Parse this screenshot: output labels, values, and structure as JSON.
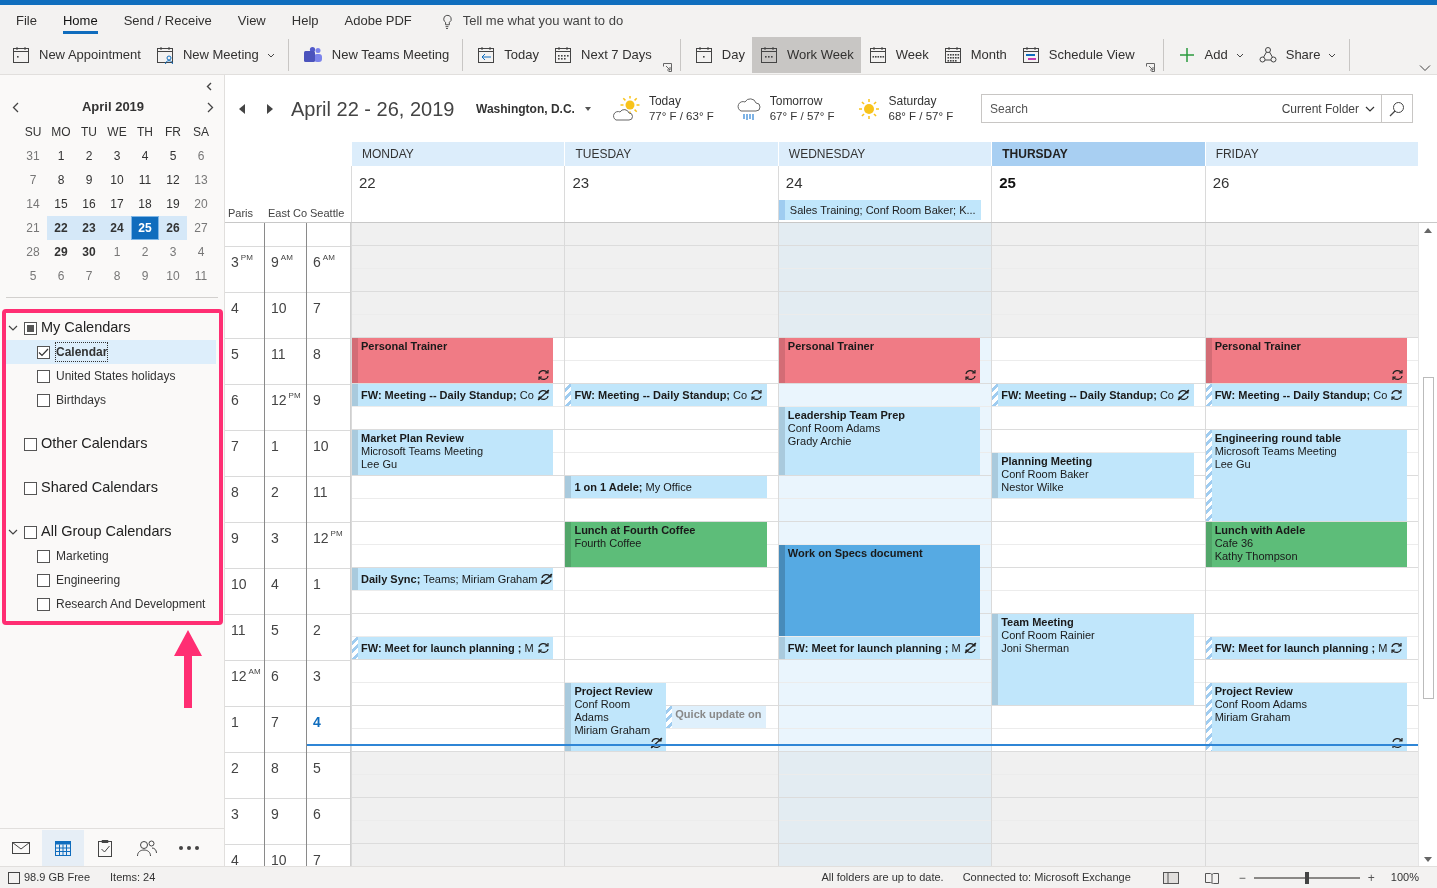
{
  "ribbon": {
    "tabs": [
      {
        "label": "File",
        "selected": false
      },
      {
        "label": "Home",
        "selected": true
      },
      {
        "label": "Send / Receive",
        "selected": false
      },
      {
        "label": "View",
        "selected": false
      },
      {
        "label": "Help",
        "selected": false
      },
      {
        "label": "Adobe PDF",
        "selected": false
      }
    ],
    "tell_me": "Tell me what you want to do",
    "groups": [
      {
        "launcher": false,
        "buttons": [
          {
            "kind": "appointment",
            "label": "New Appointment",
            "dropdown": false,
            "selected": false
          },
          {
            "kind": "meeting",
            "label": "New Meeting",
            "dropdown": true,
            "selected": false
          }
        ]
      },
      {
        "launcher": false,
        "buttons": [
          {
            "kind": "teams",
            "label": "New Teams Meeting",
            "dropdown": false,
            "selected": false
          }
        ]
      },
      {
        "launcher": true,
        "buttons": [
          {
            "kind": "today",
            "label": "Today",
            "dropdown": false,
            "selected": false
          },
          {
            "kind": "next7",
            "label": "Next 7 Days",
            "dropdown": false,
            "selected": false
          }
        ]
      },
      {
        "launcher": true,
        "buttons": [
          {
            "kind": "day",
            "label": "Day",
            "dropdown": false,
            "selected": false
          },
          {
            "kind": "workweek",
            "label": "Work Week",
            "dropdown": false,
            "selected": true
          },
          {
            "kind": "week",
            "label": "Week",
            "dropdown": false,
            "selected": false
          },
          {
            "kind": "month",
            "label": "Month",
            "dropdown": false,
            "selected": false
          },
          {
            "kind": "schedule",
            "label": "Schedule View",
            "dropdown": false,
            "selected": false
          }
        ]
      },
      {
        "launcher": false,
        "buttons": [
          {
            "kind": "add",
            "label": "Add",
            "dropdown": true,
            "selected": false
          },
          {
            "kind": "share",
            "label": "Share",
            "dropdown": true,
            "selected": false
          }
        ]
      }
    ]
  },
  "minical": {
    "title": "April 2019",
    "weekdays": [
      "SU",
      "MO",
      "TU",
      "WE",
      "TH",
      "FR",
      "SA"
    ],
    "weeks": [
      [
        {
          "d": "31",
          "muted": true,
          "bold": false,
          "selected": false,
          "today": false
        },
        {
          "d": "1",
          "muted": false,
          "bold": false,
          "selected": false,
          "today": false
        },
        {
          "d": "2",
          "muted": false,
          "bold": false,
          "selected": false,
          "today": false
        },
        {
          "d": "3",
          "muted": false,
          "bold": false,
          "selected": false,
          "today": false
        },
        {
          "d": "4",
          "muted": false,
          "bold": false,
          "selected": false,
          "today": false
        },
        {
          "d": "5",
          "muted": false,
          "bold": false,
          "selected": false,
          "today": false
        },
        {
          "d": "6",
          "muted": true,
          "bold": false,
          "selected": false,
          "today": false
        }
      ],
      [
        {
          "d": "7",
          "muted": true,
          "bold": false,
          "selected": false,
          "today": false
        },
        {
          "d": "8",
          "muted": false,
          "bold": false,
          "selected": false,
          "today": false
        },
        {
          "d": "9",
          "muted": false,
          "bold": false,
          "selected": false,
          "today": false
        },
        {
          "d": "10",
          "muted": false,
          "bold": false,
          "selected": false,
          "today": false
        },
        {
          "d": "11",
          "muted": false,
          "bold": false,
          "selected": false,
          "today": false
        },
        {
          "d": "12",
          "muted": false,
          "bold": false,
          "selected": false,
          "today": false
        },
        {
          "d": "13",
          "muted": true,
          "bold": false,
          "selected": false,
          "today": false
        }
      ],
      [
        {
          "d": "14",
          "muted": true,
          "bold": false,
          "selected": false,
          "today": false
        },
        {
          "d": "15",
          "muted": false,
          "bold": false,
          "selected": false,
          "today": false
        },
        {
          "d": "16",
          "muted": false,
          "bold": false,
          "selected": false,
          "today": false
        },
        {
          "d": "17",
          "muted": false,
          "bold": false,
          "selected": false,
          "today": false
        },
        {
          "d": "18",
          "muted": false,
          "bold": false,
          "selected": false,
          "today": false
        },
        {
          "d": "19",
          "muted": false,
          "bold": false,
          "selected": false,
          "today": false
        },
        {
          "d": "20",
          "muted": true,
          "bold": false,
          "selected": false,
          "today": false
        }
      ],
      [
        {
          "d": "21",
          "muted": true,
          "bold": false,
          "selected": false,
          "today": false
        },
        {
          "d": "22",
          "muted": false,
          "bold": true,
          "selected": true,
          "today": false
        },
        {
          "d": "23",
          "muted": false,
          "bold": true,
          "selected": true,
          "today": false
        },
        {
          "d": "24",
          "muted": false,
          "bold": true,
          "selected": true,
          "today": false
        },
        {
          "d": "25",
          "muted": false,
          "bold": true,
          "selected": true,
          "today": true
        },
        {
          "d": "26",
          "muted": false,
          "bold": true,
          "selected": true,
          "today": false
        },
        {
          "d": "27",
          "muted": true,
          "bold": false,
          "selected": false,
          "today": false
        }
      ],
      [
        {
          "d": "28",
          "muted": true,
          "bold": false,
          "selected": false,
          "today": false
        },
        {
          "d": "29",
          "muted": false,
          "bold": true,
          "selected": false,
          "today": false
        },
        {
          "d": "30",
          "muted": false,
          "bold": true,
          "selected": false,
          "today": false
        },
        {
          "d": "1",
          "muted": true,
          "bold": false,
          "selected": false,
          "today": false
        },
        {
          "d": "2",
          "muted": true,
          "bold": false,
          "selected": false,
          "today": false
        },
        {
          "d": "3",
          "muted": true,
          "bold": false,
          "selected": false,
          "today": false
        },
        {
          "d": "4",
          "muted": true,
          "bold": false,
          "selected": false,
          "today": false
        }
      ],
      [
        {
          "d": "5",
          "muted": true,
          "bold": false,
          "selected": false,
          "today": false
        },
        {
          "d": "6",
          "muted": true,
          "bold": false,
          "selected": false,
          "today": false
        },
        {
          "d": "7",
          "muted": true,
          "bold": false,
          "selected": false,
          "today": false
        },
        {
          "d": "8",
          "muted": true,
          "bold": false,
          "selected": false,
          "today": false
        },
        {
          "d": "9",
          "muted": true,
          "bold": false,
          "selected": false,
          "today": false
        },
        {
          "d": "10",
          "muted": true,
          "bold": false,
          "selected": false,
          "today": false
        },
        {
          "d": "11",
          "muted": true,
          "bold": false,
          "selected": false,
          "today": false
        }
      ]
    ]
  },
  "folders": [
    {
      "name": "My Calendars",
      "expanded": true,
      "checked": false,
      "partial": true,
      "items": [
        {
          "name": "Calendar",
          "checked": true,
          "selected": true
        },
        {
          "name": "United States holidays",
          "checked": false,
          "selected": false
        },
        {
          "name": "Birthdays",
          "checked": false,
          "selected": false
        }
      ]
    },
    {
      "name": "Other Calendars",
      "checked": false,
      "partial": false
    },
    {
      "name": "Shared Calendars",
      "checked": false,
      "partial": false
    },
    {
      "name": "All Group Calendars",
      "expanded": true,
      "checked": false,
      "partial": false,
      "items": [
        {
          "name": "Marketing",
          "checked": false,
          "selected": false
        },
        {
          "name": "Engineering",
          "checked": false,
          "selected": false
        },
        {
          "name": "Research And Development",
          "checked": false,
          "selected": false
        }
      ]
    }
  ],
  "nav": [
    {
      "kind": "mail",
      "selected": false
    },
    {
      "kind": "calendar",
      "selected": true
    },
    {
      "kind": "tasks",
      "selected": false
    },
    {
      "kind": "people",
      "selected": false
    },
    {
      "kind": "more",
      "selected": false
    }
  ],
  "header": {
    "range": "April 22 - 26, 2019",
    "location": "Washington, D.C.",
    "weather": [
      {
        "kind": "partly-sunny",
        "day": "Today",
        "temps": "77° F / 63° F"
      },
      {
        "kind": "rain",
        "day": "Tomorrow",
        "temps": "67° F / 57° F"
      },
      {
        "kind": "sunny",
        "day": "Saturday",
        "temps": "68° F / 57° F"
      }
    ],
    "search": {
      "placeholder": "Search",
      "scope": "Current Folder"
    }
  },
  "time_zones": [
    "Paris",
    "East Co",
    "Seattle"
  ],
  "hours": [
    {
      "labels": [
        [
          "3",
          "PM"
        ],
        [
          "9",
          "AM"
        ],
        [
          "6",
          "AM"
        ]
      ],
      "current": false
    },
    {
      "labels": [
        [
          "4"
        ],
        [
          "10"
        ],
        [
          "7"
        ]
      ],
      "current": false
    },
    {
      "labels": [
        [
          "5"
        ],
        [
          "11"
        ],
        [
          "8"
        ]
      ],
      "current": false
    },
    {
      "labels": [
        [
          "6"
        ],
        [
          "12",
          "PM"
        ],
        [
          "9"
        ]
      ],
      "current": false
    },
    {
      "labels": [
        [
          "7"
        ],
        [
          "1"
        ],
        [
          "10"
        ]
      ],
      "current": false
    },
    {
      "labels": [
        [
          "8"
        ],
        [
          "2"
        ],
        [
          "11"
        ]
      ],
      "current": false
    },
    {
      "labels": [
        [
          "9"
        ],
        [
          "3"
        ],
        [
          "12",
          "PM"
        ]
      ],
      "current": false
    },
    {
      "labels": [
        [
          "10"
        ],
        [
          "4"
        ],
        [
          "1"
        ]
      ],
      "current": false
    },
    {
      "labels": [
        [
          "11"
        ],
        [
          "5"
        ],
        [
          "2"
        ]
      ],
      "current": false
    },
    {
      "labels": [
        [
          "12",
          "AM"
        ],
        [
          "6"
        ],
        [
          "3"
        ]
      ],
      "current": false
    },
    {
      "labels": [
        [
          "1"
        ],
        [
          "7"
        ],
        [
          "4"
        ]
      ],
      "current": true
    },
    {
      "labels": [
        [
          "2"
        ],
        [
          "8"
        ],
        [
          "5"
        ]
      ],
      "current": false
    },
    {
      "labels": [
        [
          "3"
        ],
        [
          "9"
        ],
        [
          "6"
        ]
      ],
      "current": false
    },
    {
      "labels": [
        [
          "4"
        ],
        [
          "10"
        ],
        [
          "7"
        ]
      ],
      "current": false
    }
  ],
  "days": [
    {
      "name": "MONDAY",
      "date": "22",
      "today": false,
      "selected": false,
      "events": [
        {
          "kind": "block",
          "title": "Personal Trainer",
          "color": "#f07b85",
          "tentative": false,
          "faded": false,
          "recurring": true,
          "exception": false
        },
        {
          "kind": "inline",
          "text": "**FW: Meeting -- Daily Standup;** Co",
          "color": "#c0e6fb",
          "tentative": false,
          "faded": false,
          "recurring": true,
          "exception": true
        },
        {
          "kind": "block",
          "title": "Market Plan Review",
          "lines": [
            "Microsoft Teams Meeting",
            "Lee Gu"
          ],
          "color": "#c0e6fb",
          "tentative": false,
          "faded": false,
          "recurring": false,
          "exception": false
        },
        {
          "kind": "inline",
          "text": "**Daily Sync;** Teams; Miriam Graham",
          "color": "#c0e6fb",
          "tentative": false,
          "faded": false,
          "recurring": true,
          "exception": true
        },
        {
          "kind": "inline",
          "text": "**FW: Meet for launch planning ;** M",
          "color": "#c0e6fb",
          "tentative": true,
          "faded": false,
          "recurring": true,
          "exception": false
        }
      ]
    },
    {
      "name": "TUESDAY",
      "date": "23",
      "today": false,
      "selected": false,
      "events": [
        {
          "kind": "inline",
          "text": "**FW: Meeting -- Daily Standup;** Co",
          "color": "#c0e6fb",
          "tentative": true,
          "faded": false,
          "recurring": true,
          "exception": false
        },
        {
          "kind": "inline",
          "text": "**1 on 1 Adele;** My Office",
          "color": "#c0e6fb",
          "tentative": false,
          "faded": false,
          "recurring": false,
          "exception": false
        },
        {
          "kind": "block",
          "title": "Lunch at Fourth Coffee",
          "lines": [
            "Fourth Coffee"
          ],
          "color": "#5dbd79",
          "tentative": false,
          "faded": false,
          "recurring": false,
          "exception": false
        },
        {
          "kind": "block",
          "title": "Project Review",
          "lines": [
            "Conf Room",
            "Adams",
            "Miriam Graham"
          ],
          "color": "#c0e6fb",
          "tentative": false,
          "faded": false,
          "recurring": true,
          "exception": true
        },
        {
          "kind": "block",
          "title": "Quick update on",
          "color": "#dff0fc",
          "tentative": true,
          "faded": true,
          "recurring": false,
          "exception": false
        }
      ]
    },
    {
      "name": "WEDNESDAY",
      "date": "24",
      "today": false,
      "selected": true,
      "all_day": [
        "Sales Training; Conf Room Baker; K..."
      ],
      "events": [
        {
          "kind": "block",
          "title": "Personal Trainer",
          "color": "#f07b85",
          "tentative": false,
          "faded": false,
          "recurring": true,
          "exception": false
        },
        {
          "kind": "block",
          "title": "Leadership Team Prep",
          "lines": [
            "Conf Room Adams",
            "Grady Archie"
          ],
          "color": "#c0e6fb",
          "tentative": false,
          "faded": false,
          "recurring": false,
          "exception": false
        },
        {
          "kind": "block",
          "title": "Work on Specs document",
          "color": "#56aae3",
          "tentative": false,
          "faded": false,
          "recurring": false,
          "exception": false
        },
        {
          "kind": "inline",
          "text": "**FW: Meet for launch planning ;** M",
          "color": "#c0e6fb",
          "tentative": false,
          "faded": false,
          "recurring": true,
          "exception": true
        }
      ]
    },
    {
      "name": "THURSDAY",
      "date": "25",
      "today": true,
      "selected": false,
      "events": [
        {
          "kind": "inline",
          "text": "**FW: Meeting -- Daily Standup;** Co",
          "color": "#c0e6fb",
          "tentative": true,
          "faded": false,
          "recurring": true,
          "exception": true
        },
        {
          "kind": "block",
          "title": "Planning Meeting",
          "lines": [
            "Conf Room Baker",
            "Nestor Wilke"
          ],
          "color": "#c0e6fb",
          "tentative": false,
          "faded": false,
          "recurring": false,
          "exception": false
        },
        {
          "kind": "block",
          "title": "Team Meeting",
          "lines": [
            "Conf Room Rainier",
            "Joni Sherman"
          ],
          "color": "#c0e6fb",
          "tentative": false,
          "faded": false,
          "recurring": false,
          "exception": false
        }
      ]
    },
    {
      "name": "FRIDAY",
      "date": "26",
      "today": false,
      "selected": false,
      "events": [
        {
          "kind": "block",
          "title": "Personal Trainer",
          "color": "#f07b85",
          "tentative": false,
          "faded": false,
          "recurring": true,
          "exception": false
        },
        {
          "kind": "inline",
          "text": "**FW: Meeting -- Daily Standup;** Co",
          "color": "#c0e6fb",
          "tentative": true,
          "faded": false,
          "recurring": true,
          "exception": false
        },
        {
          "kind": "block",
          "title": "Engineering round table",
          "lines": [
            "Microsoft Teams Meeting",
            "Lee Gu"
          ],
          "color": "#c0e6fb",
          "tentative": true,
          "faded": false,
          "recurring": false,
          "exception": false
        },
        {
          "kind": "block",
          "title": "Lunch with Adele",
          "lines": [
            "Cafe 36",
            "Kathy Thompson"
          ],
          "color": "#5dbd79",
          "tentative": false,
          "faded": false,
          "recurring": false,
          "exception": false
        },
        {
          "kind": "inline",
          "text": "**FW: Meet for launch planning ;** M",
          "color": "#c0e6fb",
          "tentative": true,
          "faded": false,
          "recurring": true,
          "exception": false
        },
        {
          "kind": "block",
          "title": "Project Review",
          "lines": [
            "Conf Room Adams",
            "Miriam Graham"
          ],
          "color": "#c0e6fb",
          "tentative": true,
          "faded": false,
          "recurring": true,
          "exception": false
        }
      ]
    }
  ],
  "status": {
    "free": "98.9 GB Free",
    "items": "Items: 24",
    "sync": "All folders are up to date.",
    "connection": "Connected to: Microsoft Exchange",
    "zoom": {
      "minus": "−",
      "plus": "+",
      "label": "100%",
      "level": 0.5
    }
  }
}
